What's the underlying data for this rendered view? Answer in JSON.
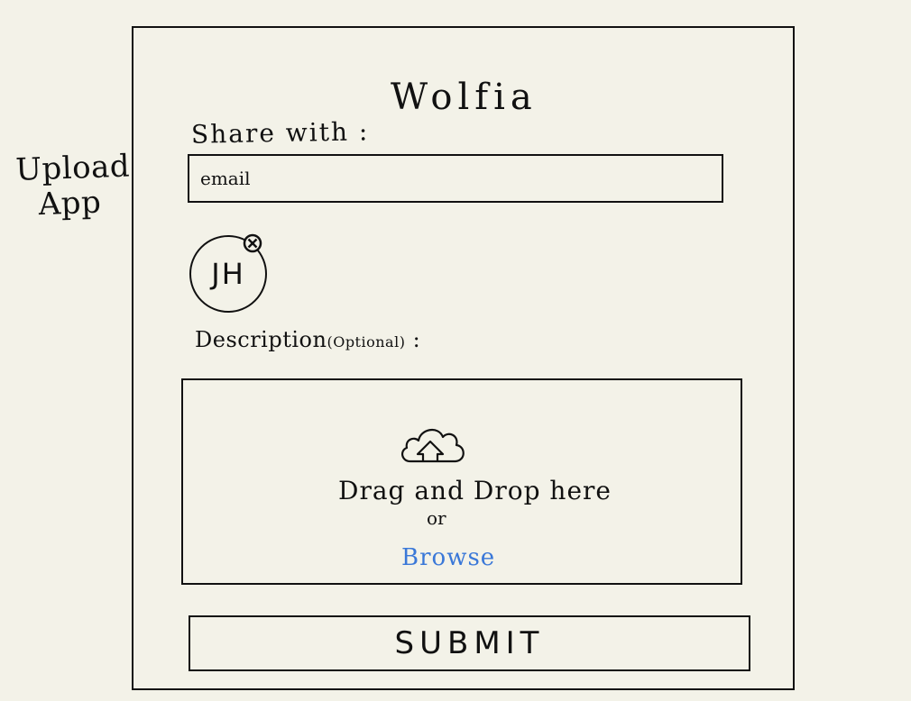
{
  "side_label": {
    "line1": "Upload",
    "line2": "App"
  },
  "form": {
    "title": "Wolfia",
    "share_label": "Share with :",
    "email_placeholder": "email",
    "recipient_chip": {
      "initials": "JH",
      "remove_icon": "close-circle-icon"
    },
    "description_label": "Description",
    "description_optional": "(Optional)",
    "description_colon": ":",
    "dropzone": {
      "icon": "cloud-upload-icon",
      "drop_text": "Drag and Drop here",
      "or_text": "or",
      "browse_label": "Browse"
    },
    "submit_label": "SUBMIT"
  },
  "colors": {
    "background": "#f3f2e8",
    "ink": "#111111",
    "link": "#3a78d8"
  }
}
